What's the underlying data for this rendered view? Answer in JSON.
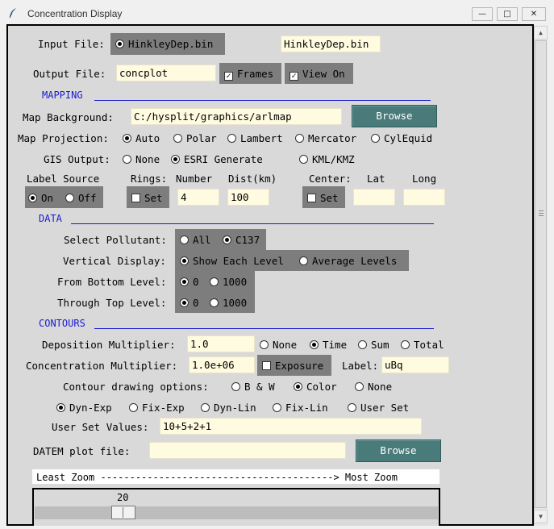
{
  "window": {
    "title": "Concentration Display"
  },
  "input_file": {
    "label": "Input File:",
    "radio_label": "HinkleyDep.bin",
    "value": "HinkleyDep.bin"
  },
  "output_file": {
    "label": "Output File:",
    "value": "concplot",
    "frames_label": "Frames",
    "view_on_label": "View On"
  },
  "mapping": {
    "section": "MAPPING",
    "background_label": "Map Background:",
    "background_value": "C:/hysplit/graphics/arlmap",
    "browse": "Browse",
    "projection_label": "Map Projection:",
    "projections": [
      "Auto",
      "Polar",
      "Lambert",
      "Mercator",
      "CylEquid"
    ],
    "gis_label": "GIS Output:",
    "gis_options": [
      "None",
      "ESRI Generate",
      "KML/KMZ"
    ],
    "label_source": {
      "label": "Label Source",
      "on": "On",
      "off": "Off"
    },
    "rings": {
      "label": "Rings:",
      "number_label": "Number",
      "dist_label": "Dist(km)",
      "set_label": "Set",
      "number": "4",
      "dist": "100"
    },
    "center": {
      "label": "Center:",
      "lat_label": "Lat",
      "long_label": "Long",
      "set_label": "Set",
      "lat": "",
      "long": ""
    }
  },
  "data": {
    "section": "DATA",
    "pollutant_label": "Select Pollutant:",
    "pollutants": [
      "All",
      "C137"
    ],
    "vertical_label": "Vertical Display:",
    "vertical_options": [
      "Show Each Level",
      "Average Levels"
    ],
    "bottom_label": "From Bottom Level:",
    "bottom_options": [
      "0",
      "1000"
    ],
    "top_label": "Through Top Level:",
    "top_options": [
      "0",
      "1000"
    ]
  },
  "contours": {
    "section": "CONTOURS",
    "dep_mult_label": "Deposition Multiplier:",
    "dep_mult_value": "1.0",
    "dep_options": [
      "None",
      "Time",
      "Sum",
      "Total"
    ],
    "conc_mult_label": "Concentration Multiplier:",
    "conc_mult_value": "1.0e+06",
    "exposure_label": "Exposure",
    "units_label": "Label:",
    "units_value": "uBq",
    "drawing_label": "Contour drawing options:",
    "drawing_options": [
      "B & W",
      "Color",
      "None"
    ],
    "interval_options": [
      "Dyn-Exp",
      "Fix-Exp",
      "Dyn-Lin",
      "Fix-Lin",
      "User Set"
    ],
    "user_values_label": "User Set Values:",
    "user_values": "10+5+2+1"
  },
  "datem": {
    "label": "DATEM plot file:",
    "value": "",
    "browse": "Browse"
  },
  "zoom": {
    "label": "Least Zoom ----------------------------------------> Most Zoom",
    "value": "20",
    "fraction": 0.2
  }
}
